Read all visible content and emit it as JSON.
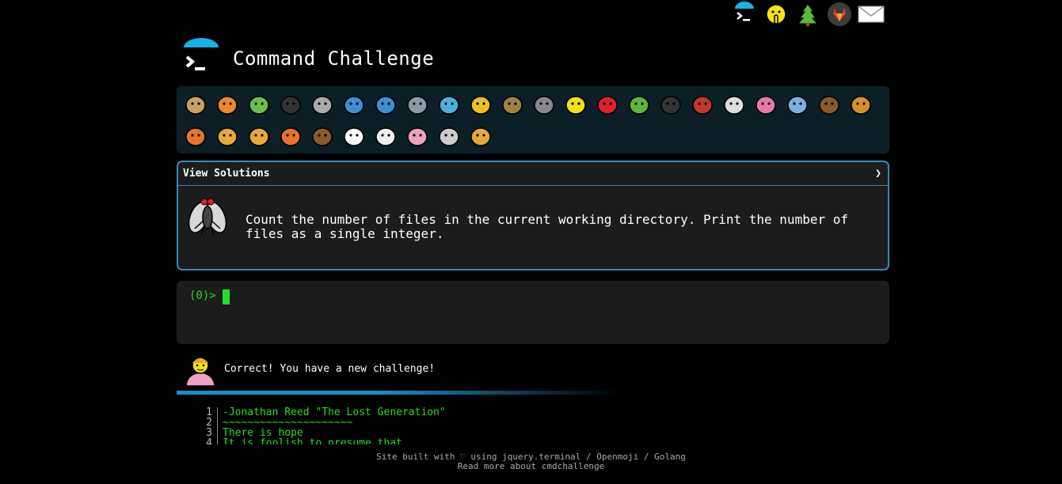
{
  "app": {
    "title": "Command Challenge"
  },
  "topnav": [
    {
      "name": "cmdchallenge-logo-icon"
    },
    {
      "name": "shushing-face-icon"
    },
    {
      "name": "christmas-tree-icon"
    },
    {
      "name": "gitlab-icon"
    },
    {
      "name": "envelope-icon"
    }
  ],
  "challenges": [
    "snail",
    "butterfly",
    "caterpillar",
    "ant",
    "spider-web",
    "whale",
    "dolphin-blue",
    "dolphin-gray",
    "fish",
    "tropical-fish",
    "blowfish",
    "wolf",
    "bee",
    "ladybug",
    "cricket",
    "spider",
    "scorpion",
    "fly",
    "worm",
    "microbe",
    "chimpanzee",
    "dog",
    "fox",
    "cat",
    "lion",
    "tiger",
    "horse",
    "unicorn",
    "cow",
    "pig",
    "mouse",
    "hamster"
  ],
  "solutions": {
    "label": "View Solutions",
    "chevron": "❯",
    "task": "Count the number of files in the current working directory. Print the number of files as a single integer."
  },
  "terminal": {
    "prompt": "(0)>"
  },
  "message": {
    "text": "Correct! You have a new challenge!"
  },
  "quote": {
    "lines": [
      {
        "num": "1",
        "text": "-Jonathan Reed \"The Lost Generation\""
      },
      {
        "num": "2",
        "text": "~~~~~~~~~~~~~~~~~~~~~"
      },
      {
        "num": "3",
        "text": "There is hope"
      },
      {
        "num": "4",
        "text": "It is foolish to presume that"
      }
    ]
  },
  "footer": {
    "line1": "Site built with ♡ using jquery.terminal / Openmoji / Golang",
    "line2": "Read more about cmdchallenge"
  },
  "colors": {
    "accent": "#2c8fb5",
    "terminal_green": "#20e020",
    "panel_bg": "#1c1c1c",
    "bar_bg": "#0c1f26"
  }
}
